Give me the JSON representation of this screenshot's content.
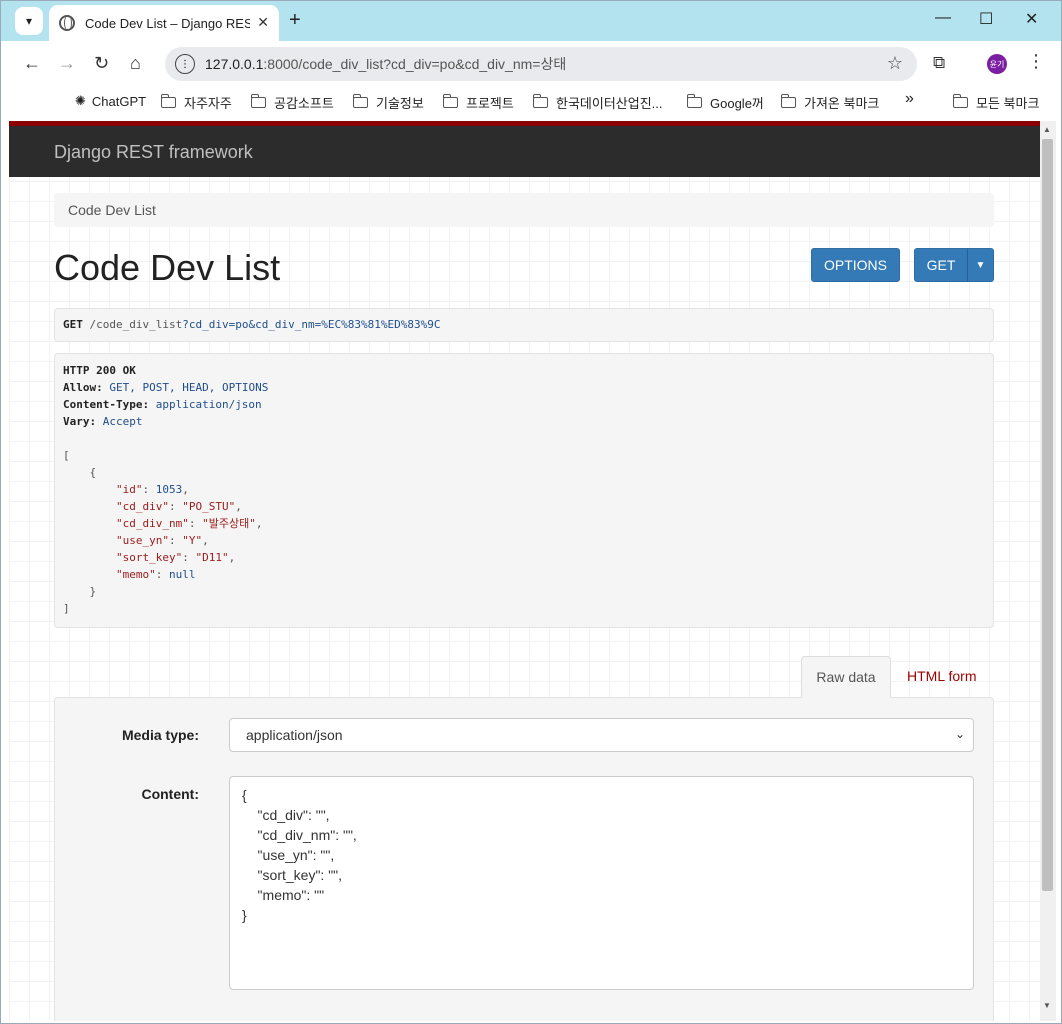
{
  "browser": {
    "tab_title": "Code Dev List – Django REST framework",
    "tab_close": "✕",
    "new_tab": "+",
    "url_host": "127.0.0.1",
    "url_path": ":8000/code_div_list?cd_div=po&cd_div_nm=상태",
    "profile_initials": "윤기",
    "bookmarks": [
      {
        "label": "ChatGPT"
      },
      {
        "label": "자주자주"
      },
      {
        "label": "공감소프트"
      },
      {
        "label": "기술정보"
      },
      {
        "label": "프로젝트"
      },
      {
        "label": "한국데이터산업진..."
      },
      {
        "label": "Google꺼"
      },
      {
        "label": "가져온 북마크"
      },
      {
        "label": "모든 북마크"
      }
    ],
    "more_bookmarks": "»"
  },
  "drf": {
    "brand": "Django REST framework",
    "breadcrumb": "Code Dev List",
    "page_title": "Code Dev List",
    "options_label": "OPTIONS",
    "get_label": "GET",
    "request_method": "GET",
    "request_path": "/code_div_list",
    "request_query": "?cd_div=po&cd_div_nm=%EC%83%81%ED%83%9C",
    "response": {
      "status": "HTTP 200 OK",
      "allow_key": "Allow:",
      "allow_val": "GET, POST, HEAD, OPTIONS",
      "ctype_key": "Content-Type:",
      "ctype_val": "application/json",
      "vary_key": "Vary:",
      "vary_val": "Accept",
      "record": {
        "id": "1053",
        "cd_div": "\"PO_STU\"",
        "cd_div_nm": "\"발주상태\"",
        "use_yn": "\"Y\"",
        "sort_key": "\"D11\"",
        "memo": "null"
      }
    },
    "tabs": {
      "raw": "Raw data",
      "html": "HTML form"
    },
    "form": {
      "media_label": "Media type:",
      "media_value": "application/json",
      "content_label": "Content:",
      "content_value": "{\n    \"cd_div\": \"\",\n    \"cd_div_nm\": \"\",\n    \"use_yn\": \"\",\n    \"sort_key\": \"\",\n    \"memo\": \"\"\n}"
    }
  }
}
